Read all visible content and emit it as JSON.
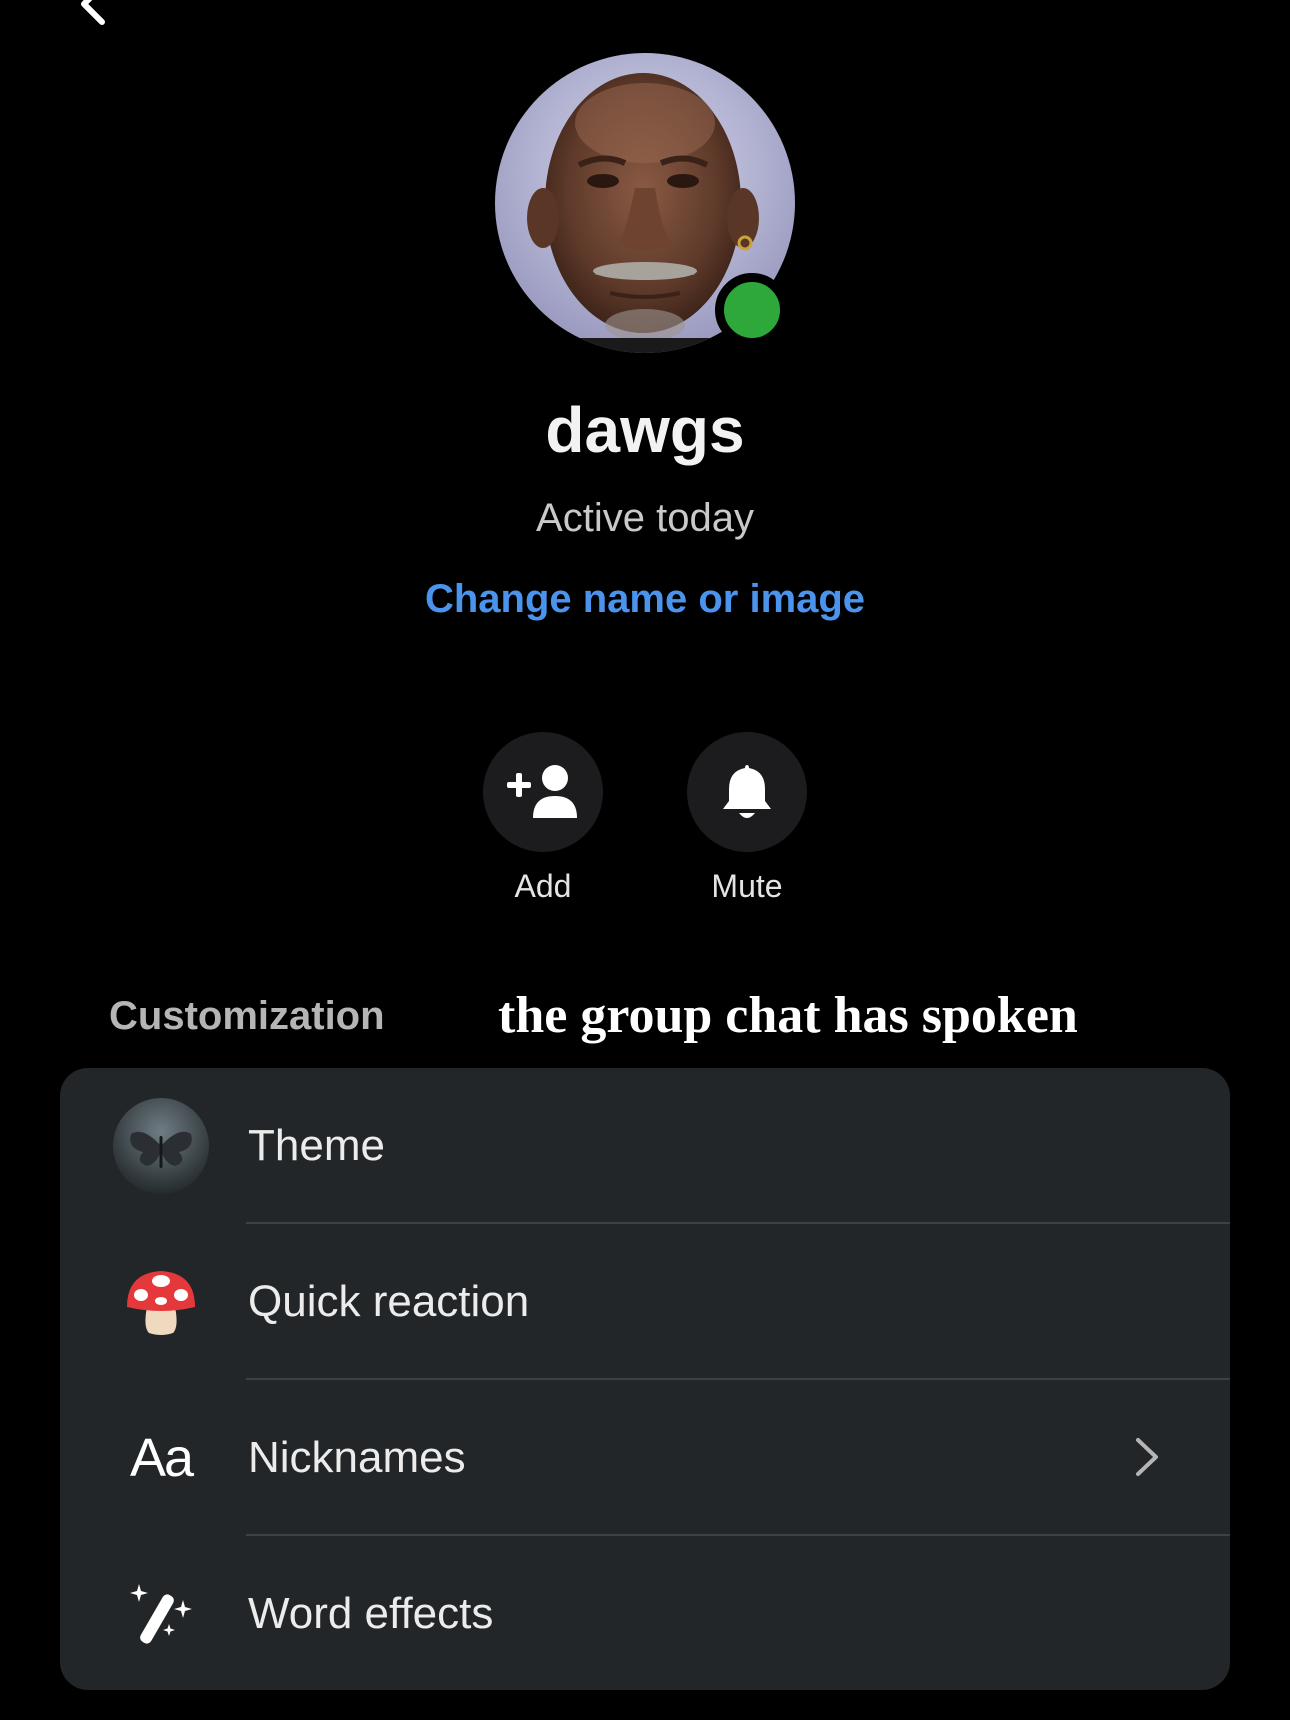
{
  "header": {
    "back_icon": "chevron-left-icon"
  },
  "profile": {
    "name": "dawgs",
    "status": "Active today",
    "change_link": "Change name or image",
    "online_color": "#2ea83a"
  },
  "actions": [
    {
      "label": "Add",
      "icon": "add-person-icon"
    },
    {
      "label": "Mute",
      "icon": "bell-icon"
    }
  ],
  "section": {
    "title": "Customization"
  },
  "overlay_caption": "the group chat has spoken",
  "settings": {
    "items": [
      {
        "label": "Theme",
        "icon": "theme-thumbnail-icon"
      },
      {
        "label": "Quick reaction",
        "icon": "mushroom-emoji-icon"
      },
      {
        "label": "Nicknames",
        "icon": "aa-text-icon",
        "glyph": "Aa"
      },
      {
        "label": "Word effects",
        "icon": "magic-wand-icon"
      }
    ]
  },
  "colors": {
    "background": "#000000",
    "card": "#222628",
    "link": "#4b94ee"
  }
}
